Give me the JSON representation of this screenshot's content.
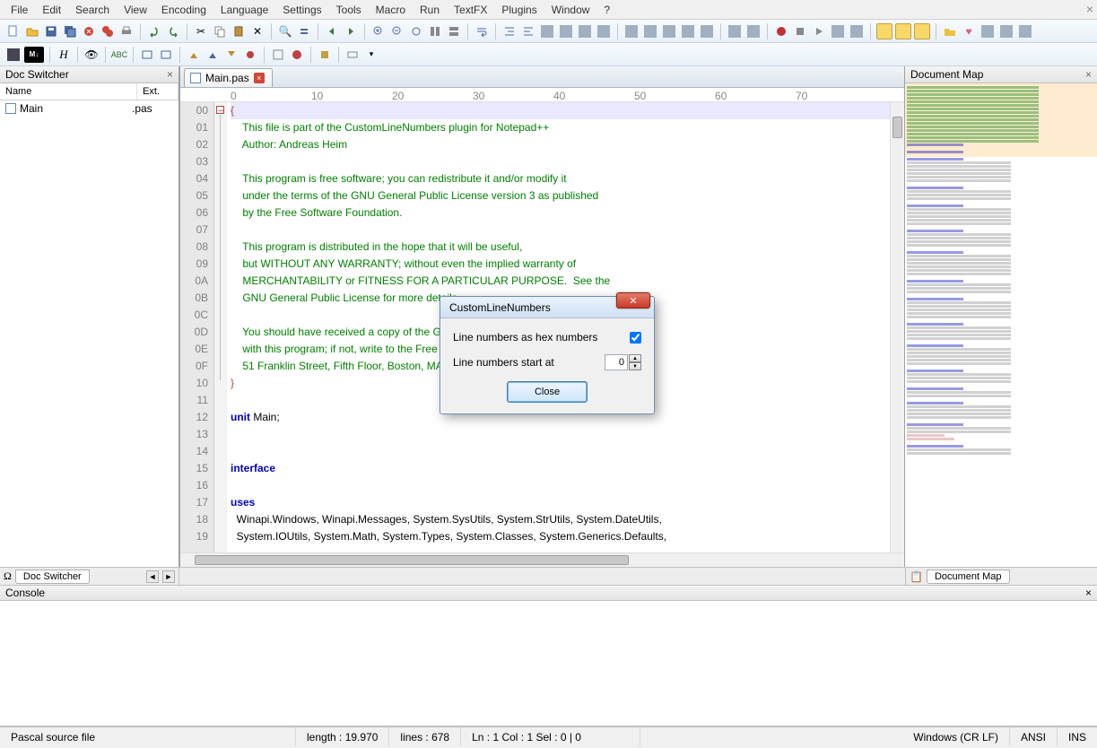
{
  "menu": [
    "File",
    "Edit",
    "Search",
    "View",
    "Encoding",
    "Language",
    "Settings",
    "Tools",
    "Macro",
    "Run",
    "TextFX",
    "Plugins",
    "Window",
    "?"
  ],
  "panels": {
    "docswitcher_title": "Doc Switcher",
    "docmap_title": "Document Map",
    "console_title": "Console"
  },
  "docswitcher": {
    "cols": {
      "name": "Name",
      "ext": "Ext."
    },
    "rows": [
      {
        "name": "Main",
        "ext": ".pas"
      }
    ]
  },
  "tab": {
    "label": "Main.pas"
  },
  "gutter": [
    "00",
    "01",
    "02",
    "03",
    "04",
    "05",
    "06",
    "07",
    "08",
    "09",
    "0A",
    "0B",
    "0C",
    "0D",
    "0E",
    "0F",
    "10",
    "11",
    "12",
    "13",
    "14",
    "15",
    "16",
    "17",
    "18",
    "19"
  ],
  "code": {
    "l00": "{",
    "l01": "    This file is part of the CustomLineNumbers plugin for Notepad++",
    "l02": "    Author: Andreas Heim",
    "l03": "",
    "l04": "    This program is free software; you can redistribute it and/or modify it",
    "l05": "    under the terms of the GNU General Public License version 3 as published",
    "l06": "    by the Free Software Foundation.",
    "l07": "",
    "l08": "    This program is distributed in the hope that it will be useful,",
    "l09": "    but WITHOUT ANY WARRANTY; without even the implied warranty of",
    "l0A": "    MERCHANTABILITY or FITNESS FOR A PARTICULAR PURPOSE.  See the",
    "l0B": "    GNU General Public License for more details.",
    "l0C": "",
    "l0D": "    You should have received a copy of the GNU General Public License along",
    "l0E": "    with this program; if not, write to the Free Software Foundation, Inc.,",
    "l0F": "    51 Franklin Street, Fifth Floor, Boston, MA 02110-1301 USA.",
    "l10": "}",
    "l11": "",
    "l12a": "unit",
    "l12b": " Main;",
    "l13": "",
    "l14": "",
    "l15": "interface",
    "l16": "",
    "l17": "uses",
    "l18": "  Winapi.Windows, Winapi.Messages, System.SysUtils, System.StrUtils, System.DateUtils,",
    "l19": "  System.IOUtils, System.Math, System.Types, System.Classes, System.Generics.Defaults,"
  },
  "dialog": {
    "title": "CustomLineNumbers",
    "opt_hex": "Line numbers as hex numbers",
    "opt_start": "Line numbers start at",
    "start_value": "0",
    "close": "Close"
  },
  "bottom_tabs": {
    "left": "Doc Switcher",
    "right": "Document Map"
  },
  "status": {
    "filetype": "Pascal source file",
    "length": "length : 19.970",
    "lines": "lines : 678",
    "pos": "Ln : 1    Col : 1    Sel : 0 | 0",
    "eol": "Windows (CR LF)",
    "enc": "ANSI",
    "ins": "INS"
  },
  "ruler_marks": [
    "0",
    "10",
    "20",
    "30",
    "40",
    "50",
    "60",
    "70"
  ]
}
